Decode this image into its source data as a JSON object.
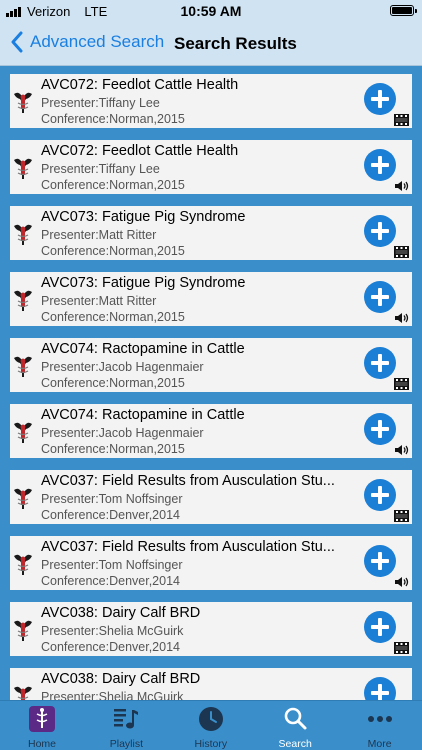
{
  "status_bar": {
    "carrier": "Verizon",
    "network": "LTE",
    "time": "10:59 AM"
  },
  "nav": {
    "back_label": "Advanced Search",
    "title": "Search Results"
  },
  "results": [
    {
      "title": "AVC072: Feedlot Cattle Health",
      "presenter": "Presenter:Tiffany Lee",
      "conference": "Conference:Norman,2015",
      "media": "video"
    },
    {
      "title": "AVC072: Feedlot Cattle Health",
      "presenter": "Presenter:Tiffany Lee",
      "conference": "Conference:Norman,2015",
      "media": "audio"
    },
    {
      "title": "AVC073: Fatigue Pig Syndrome",
      "presenter": "Presenter:Matt Ritter",
      "conference": "Conference:Norman,2015",
      "media": "video"
    },
    {
      "title": "AVC073: Fatigue Pig Syndrome",
      "presenter": "Presenter:Matt Ritter",
      "conference": "Conference:Norman,2015",
      "media": "audio"
    },
    {
      "title": "AVC074: Ractopamine in Cattle",
      "presenter": "Presenter:Jacob Hagenmaier",
      "conference": "Conference:Norman,2015",
      "media": "video"
    },
    {
      "title": "AVC074: Ractopamine in Cattle",
      "presenter": "Presenter:Jacob Hagenmaier",
      "conference": "Conference:Norman,2015",
      "media": "audio"
    },
    {
      "title": "AVC037: Field Results from Ausculation Stu...",
      "presenter": "Presenter:Tom Noffsinger",
      "conference": "Conference:Denver,2014",
      "media": "video"
    },
    {
      "title": "AVC037: Field Results from Ausculation Stu...",
      "presenter": "Presenter:Tom Noffsinger",
      "conference": "Conference:Denver,2014",
      "media": "audio"
    },
    {
      "title": "AVC038: Dairy Calf BRD",
      "presenter": "Presenter:Shelia McGuirk",
      "conference": "Conference:Denver,2014",
      "media": "video"
    },
    {
      "title": "AVC038: Dairy Calf BRD",
      "presenter": "Presenter:Shelia McGuirk",
      "conference": "",
      "media": ""
    }
  ],
  "tabs": [
    {
      "label": "Home",
      "icon": "caduceus-icon",
      "active": false
    },
    {
      "label": "Playlist",
      "icon": "playlist-icon",
      "active": false
    },
    {
      "label": "History",
      "icon": "clock-icon",
      "active": false
    },
    {
      "label": "Search",
      "icon": "search-icon",
      "active": true
    },
    {
      "label": "More",
      "icon": "more-icon",
      "active": false
    }
  ],
  "colors": {
    "accent": "#1b7fd6",
    "background": "#3a8fcb",
    "header": "#cfe3f3"
  }
}
